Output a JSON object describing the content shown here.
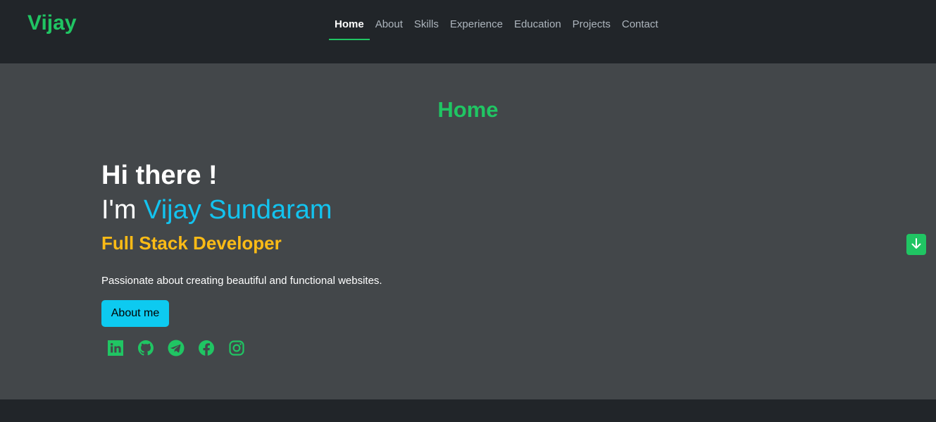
{
  "brand": "Vijay",
  "nav": {
    "items": [
      {
        "label": "Home",
        "active": true
      },
      {
        "label": "About",
        "active": false
      },
      {
        "label": "Skills",
        "active": false
      },
      {
        "label": "Experience",
        "active": false
      },
      {
        "label": "Education",
        "active": false
      },
      {
        "label": "Projects",
        "active": false
      },
      {
        "label": "Contact",
        "active": false
      }
    ]
  },
  "hero": {
    "section_title": "Home",
    "greeting": "Hi there !",
    "intro_prefix": "I'm ",
    "name": "Vijay Sundaram",
    "role": "Full Stack Developer",
    "tagline": "Passionate about creating beautiful and functional websites.",
    "about_button": "About me",
    "socials": [
      "linkedin-icon",
      "github-icon",
      "telegram-icon",
      "facebook-icon",
      "instagram-icon"
    ]
  },
  "scroll_button_icon": "arrow-down-icon",
  "colors": {
    "accent_green": "#20c563",
    "name_cyan": "#13c3ef",
    "role_yellow": "#fbbb16",
    "button_cyan": "#0dcaf0",
    "nav_bg": "#212529",
    "hero_bg": "#43474a"
  }
}
